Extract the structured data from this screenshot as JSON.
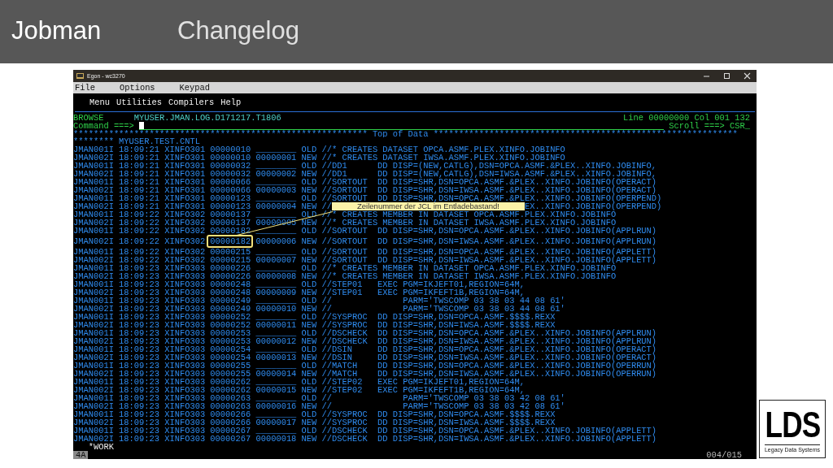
{
  "slide": {
    "title": "Jobman",
    "subtitle": "Changelog",
    "page": "004/015",
    "logo": {
      "mark": "LDS",
      "caption": "Legacy Data Systems"
    }
  },
  "window": {
    "title": "Egon - wc3270",
    "menu": [
      "File",
      "Options",
      "Keypad"
    ]
  },
  "terminal": {
    "menu": [
      "Menu",
      "Utilities",
      "Compilers",
      "Help"
    ],
    "mode": "BROWSE",
    "dataset": "MYUSER.JMAN.LOG.D171217.T1806",
    "position": "Line 00000000 Col 001 132",
    "command_label": "Command ===>",
    "scroll": "Scroll ===> CSR_",
    "top_of_data": "********************************************************** Top of Data ************************************************************",
    "member": "******** MYUSER.TEST.CNTL",
    "rows": [
      {
        "text": "JMAN001I 18:09:21 XINFO301 00000010 ________ OLD //* CREATES DATASET OPCA.ASMF.PLEX.XINFO.JOBINFO",
        "highlighted": false
      },
      {
        "text": "JMAN002I 18:09:21 XINFO301 00000010 00000001 NEW //* CREATES DATASET IWSA.ASMF.PLEX.XINFO.JOBINFO",
        "highlighted": false
      },
      {
        "text": "JMAN001I 18:09:21 XINFO301 00000032 ________ OLD //DD1      DD DISP=(NEW,CATLG),DSN=OPCA.ASMF.&PLEX..XINFO.JOBINFO,",
        "highlighted": false
      },
      {
        "text": "JMAN002I 18:09:21 XINFO301 00000032 00000002 NEW //DD1      DD DISP=(NEW,CATLG),DSN=IWSA.ASMF.&PLEX..XINFO.JOBINFO,",
        "highlighted": false
      },
      {
        "text": "JMAN001I 18:09:21 XINFO301 00000066 ________ OLD //SORTOUT  DD DISP=SHR,DSN=OPCA.ASMF.&PLEX..XINFO.JOBINFO(OPERACT)",
        "highlighted": false
      },
      {
        "text": "JMAN002I 18:09:21 XINFO301 00000066 00000003 NEW //SORTOUT  DD DISP=SHR,DSN=IWSA.ASMF.&PLEX..XINFO.JOBINFO(OPERACT)",
        "highlighted": false
      },
      {
        "text": "JMAN001I 18:09:21 XINFO301 00000123 ________ OLD //SORTOUT  DD DISP=SHR,DSN=OPCA.ASMF.&PLEX..XINFO.JOBINFO(OPERPEND)",
        "highlighted": false
      },
      {
        "text": "JMAN002I 18:09:21 XINFO301 00000123 00000004 NEW //",
        "tail": "EX..XINFO.JOBINFO(OPERPEND)",
        "highlighted": false
      },
      {
        "text": "JMAN001I 18:09:22 XINFO302 00000137 ________ OLD //* CREATES MEMBER IN DATASET OPCA.ASMF.PLEX.XINFO.JOBINFO",
        "highlighted": false
      },
      {
        "text": "JMAN002I 18:09:22 XINFO302 00000137 00000005 NEW //* CREATES MEMBER IN DATASET IWSA.ASMF.PLEX.XINFO.JOBINFO",
        "highlighted": false
      },
      {
        "text": "JMAN001I 18:09:22 XINFO302 00000182 ________ OLD //SORTOUT  DD DISP=SHR,DSN=OPCA.ASMF.&PLEX..XINFO.JOBINFO(APPLRUN)",
        "highlighted": false
      },
      {
        "text": "JMAN002I 18:09:22 XINFO302 00000182 00000006 NEW //SORTOUT  DD DISP=SHR,DSN=IWSA.ASMF.&PLEX..XINFO.JOBINFO(APPLRUN)",
        "highlighted": true
      },
      {
        "text": "JMAN001I 18:09:22 XINFO302 00000215 ________ OLD //SORTOUT  DD DISP=SHR,DSN=OPCA.ASMF.&PLEX..XINFO.JOBINFO(APPLETT)",
        "highlighted": false
      },
      {
        "text": "JMAN002I 18:09:22 XINFO302 00000215 00000007 NEW //SORTOUT  DD DISP=SHR,DSN=IWSA.ASMF.&PLEX..XINFO.JOBINFO(APPLETT)",
        "highlighted": false
      },
      {
        "text": "JMAN001I 18:09:23 XINFO303 00000226 ________ OLD //* CREATES MEMBER IN DATASET OPCA.ASMF.PLEX.XINFO.JOBINFO",
        "highlighted": false
      },
      {
        "text": "JMAN002I 18:09:23 XINFO303 00000226 00000008 NEW //* CREATES MEMBER IN DATASET IWSA.ASMF.PLEX.XINFO.JOBINFO",
        "highlighted": false
      },
      {
        "text": "JMAN001I 18:09:23 XINFO303 00000248 ________ OLD //STEP01   EXEC PGM=IKJEFT01,REGION=64M,",
        "highlighted": false
      },
      {
        "text": "JMAN002I 18:09:23 XINFO303 00000248 00000009 NEW //STEP01   EXEC PGM=IKFEFT1B,REGION=64M,",
        "highlighted": false
      },
      {
        "text": "JMAN001I 18:09:23 XINFO303 00000249 ________ OLD //              PARM='TWSCOMP 03 38 03 44 08 61'",
        "highlighted": false
      },
      {
        "text": "JMAN002I 18:09:23 XINFO303 00000249 00000010 NEW //              PARM='TWSCOMP 03 38 03 44 08 61'",
        "highlighted": false
      },
      {
        "text": "JMAN001I 18:09:23 XINFO303 00000252 ________ OLD //SYSPROC  DD DISP=SHR,DSN=OPCA.ASMF.$$$$.REXX",
        "highlighted": false
      },
      {
        "text": "JMAN002I 18:09:23 XINFO303 00000252 00000011 NEW //SYSPROC  DD DISP=SHR,DSN=IWSA.ASMF.$$$$.REXX",
        "highlighted": false
      },
      {
        "text": "JMAN001I 18:09:23 XINFO303 00000253 ________ OLD //DSCHECK  DD DISP=SHR,DSN=OPCA.ASMF.&PLEX..XINFO.JOBINFO(APPLRUN)",
        "highlighted": false
      },
      {
        "text": "JMAN002I 18:09:23 XINFO303 00000253 00000012 NEW //DSCHECK  DD DISP=SHR,DSN=IWSA.ASMF.&PLEX..XINFO.JOBINFO(APPLRUN)",
        "highlighted": false
      },
      {
        "text": "JMAN001I 18:09:23 XINFO303 00000254 ________ OLD //DSIN     DD DISP=SHR,DSN=OPCA.ASMF.&PLEX..XINFO.JOBINFO(OPERACT)",
        "highlighted": false
      },
      {
        "text": "JMAN002I 18:09:23 XINFO303 00000254 00000013 NEW //DSIN     DD DISP=SHR,DSN=IWSA.ASMF.&PLEX..XINFO.JOBINFO(OPERACT)",
        "highlighted": false
      },
      {
        "text": "JMAN001I 18:09:23 XINFO303 00000255 ________ OLD //MATCH    DD DISP=SHR,DSN=OPCA.ASMF.&PLEX..XINFO.JOBINFO(OPERRUN)",
        "highlighted": false
      },
      {
        "text": "JMAN002I 18:09:23 XINFO303 00000255 00000014 NEW //MATCH    DD DISP=SHR,DSN=IWSA.ASMF.&PLEX..XINFO.JOBINFO(OPERRUN)",
        "highlighted": false
      },
      {
        "text": "JMAN001I 18:09:23 XINFO303 00000262 ________ OLD //STEP02   EXEC PGM=IKJEFT01,REGION=64M,",
        "highlighted": false
      },
      {
        "text": "JMAN002I 18:09:23 XINFO303 00000262 00000015 NEW //STEP02   EXEC PGM=IKFEFT1B,REGION=64M,",
        "highlighted": false
      },
      {
        "text": "JMAN001I 18:09:23 XINFO303 00000263 ________ OLD //              PARM='TWSCOMP 03 38 03 42 08 61'",
        "highlighted": false
      },
      {
        "text": "JMAN002I 18:09:23 XINFO303 00000263 00000016 NEW //              PARM='TWSCOMP 03 38 03 42 08 61'",
        "highlighted": false
      },
      {
        "text": "JMAN001I 18:09:23 XINFO303 00000266 ________ OLD //SYSPROC  DD DISP=SHR,DSN=OPCA.ASMF.$$$$.REXX",
        "highlighted": false
      },
      {
        "text": "JMAN002I 18:09:23 XINFO303 00000266 00000017 NEW //SYSPROC  DD DISP=SHR,DSN=IWSA.ASMF.$$$$.REXX",
        "highlighted": false
      },
      {
        "text": "JMAN001I 18:09:23 XINFO303 00000267 ________ OLD //DSCHECK  DD DISP=SHR,DSN=OPCA.ASMF.&PLEX..XINFO.JOBINFO(APPLETT)",
        "highlighted": false
      },
      {
        "text": "JMAN002I 18:09:23 XINFO303 00000267 00000018 NEW //DSCHECK  DD DISP=SHR,DSN=IWSA.ASMF.&PLEX..XINFO.JOBINFO(APPLETT)",
        "highlighted": false
      }
    ],
    "work": "*WORK",
    "session": "4A"
  },
  "callout": {
    "text": "Zeilenummer der JCL im Entladebastand!"
  }
}
